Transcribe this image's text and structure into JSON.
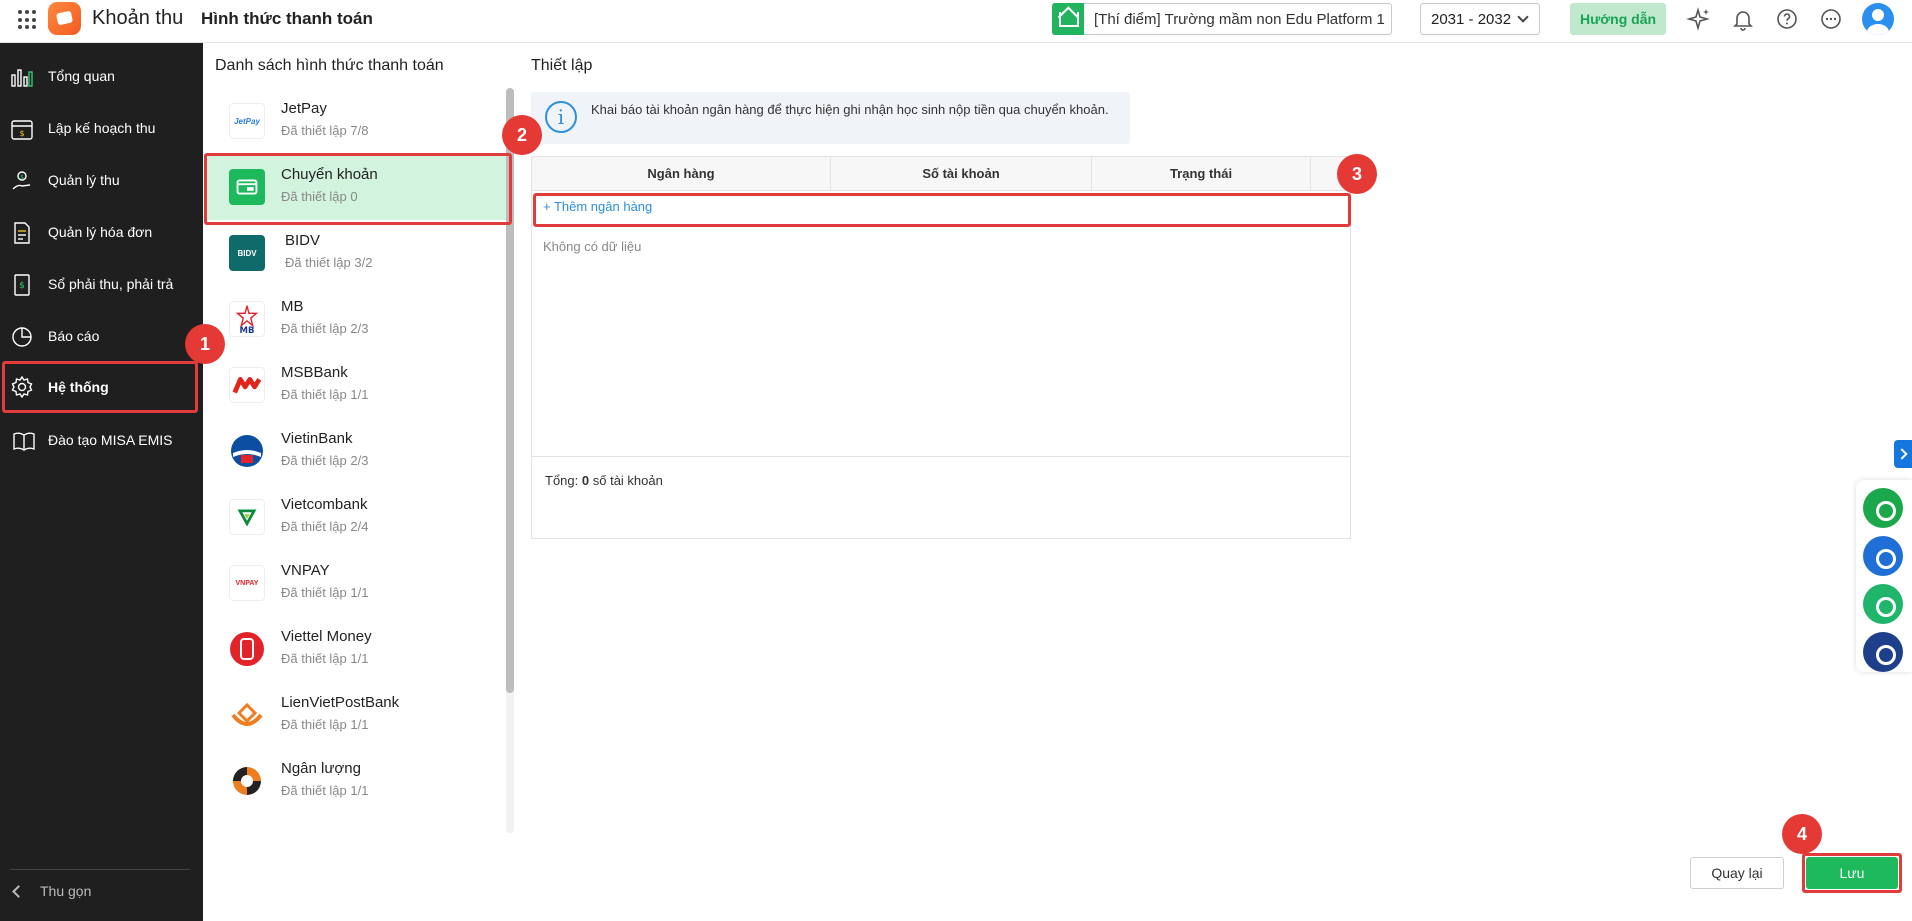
{
  "topbar": {
    "app_name": "Khoản thu",
    "page_title": "Hình thức thanh toán",
    "school": "[Thí điểm] Trường mầm non Edu Platform 1",
    "year": "2031 - 2032",
    "guide_label": "Hướng dẫn",
    "icons": [
      "apps-grid-icon",
      "sparkle-icon",
      "bell-icon",
      "help-icon",
      "more-icon",
      "user-avatar-icon"
    ]
  },
  "sidebar": {
    "items": [
      {
        "label": "Tổng quan",
        "icon": "chart-bars-icon"
      },
      {
        "label": "Lập kế hoạch thu",
        "icon": "calendar-money-icon"
      },
      {
        "label": "Quản lý thu",
        "icon": "hand-coin-icon"
      },
      {
        "label": "Quản lý hóa đơn",
        "icon": "invoice-icon"
      },
      {
        "label": "Sổ phải thu, phải trả",
        "icon": "ledger-icon"
      },
      {
        "label": "Báo cáo",
        "icon": "pie-chart-icon"
      },
      {
        "label": "Hệ thống",
        "icon": "gear-icon"
      },
      {
        "label": "Đào tạo MISA EMIS",
        "icon": "book-icon"
      }
    ],
    "active": "Hệ thống",
    "collapse_label": "Thu gọn"
  },
  "payment_list": {
    "title": "Danh sách hình thức thanh toán",
    "items": [
      {
        "name": "JetPay",
        "status": "Đã thiết lập 7/8",
        "logo_text": "JetPay",
        "logo_color": "#2a7de1"
      },
      {
        "name": "Chuyển khoản",
        "status": "Đã thiết lập 0",
        "logo_text": "",
        "logo_color": "#1db95c"
      },
      {
        "name": "BIDV",
        "status": "Đã thiết lập 3/2",
        "logo_text": "BIDV",
        "logo_color": "#0f6a6a"
      },
      {
        "name": "MB",
        "status": "Đã thiết lập 2/3",
        "logo_text": "MB",
        "logo_color": "#1d3b8f"
      },
      {
        "name": "MSBBank",
        "status": "Đã thiết lập 1/1",
        "logo_text": "",
        "logo_color": "#e1251b"
      },
      {
        "name": "VietinBank",
        "status": "Đã thiết lập 2/3",
        "logo_text": "",
        "logo_color": "#0c4ea2"
      },
      {
        "name": "Vietcombank",
        "status": "Đã thiết lập 2/4",
        "logo_text": "",
        "logo_color": "#0a8a3a"
      },
      {
        "name": "VNPAY",
        "status": "Đã thiết lập 1/1",
        "logo_text": "VNPAY",
        "logo_color": "#d7262d"
      },
      {
        "name": "Viettel Money",
        "status": "Đã thiết lập 1/1",
        "logo_text": "",
        "logo_color": "#e2232a"
      },
      {
        "name": "LienVietPostBank",
        "status": "Đã thiết lập 1/1",
        "logo_text": "",
        "logo_color": "#f07d1f"
      },
      {
        "name": "Ngân lượng",
        "status": "Đã thiết lập 1/1",
        "logo_text": "",
        "logo_color": "#f07d1f"
      }
    ],
    "selected": "Chuyển khoản"
  },
  "settings": {
    "title": "Thiết lập",
    "info": "Khai báo tài khoản ngân hàng để thực hiện ghi nhận học sinh nộp tiền qua chuyển khoản.",
    "table": {
      "columns": [
        "Ngân hàng",
        "Số tài khoản",
        "Trạng thái"
      ],
      "add_label": "+ Thêm ngân hàng",
      "empty": "Không có dữ liệu",
      "total_prefix": "Tổng:",
      "total_count": "0",
      "total_suffix": "số tài khoản"
    }
  },
  "actions": {
    "back": "Quay lại",
    "save": "Lưu"
  },
  "badges": [
    "1",
    "2",
    "3",
    "4"
  ],
  "colors": {
    "accent": "#1db95c",
    "highlight": "#e23b3b",
    "sidebar_bg": "#1f1f20",
    "link": "#2c8fd8"
  }
}
